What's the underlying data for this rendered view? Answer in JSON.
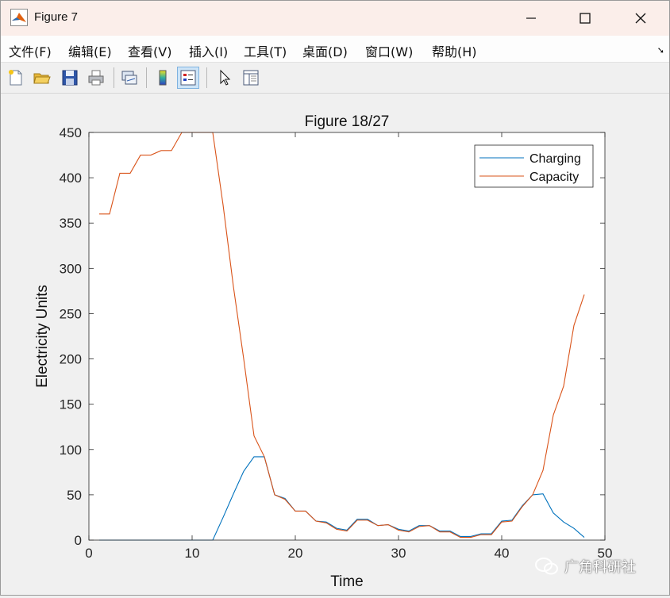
{
  "window": {
    "title": "Figure 7"
  },
  "menu": {
    "items": [
      "文件(F)",
      "编辑(E)",
      "查看(V)",
      "插入(I)",
      "工具(T)",
      "桌面(D)",
      "窗口(W)",
      "帮助(H)"
    ]
  },
  "toolbar": {
    "buttons": [
      "new-figure",
      "open-file",
      "save",
      "print",
      "link-plot",
      "insert-colorbar",
      "insert-legend",
      "edit-plot-pointer",
      "property-inspector"
    ],
    "active": "insert-legend"
  },
  "watermark": {
    "text": "广角科研社"
  },
  "colors": {
    "charging": "#0072BD",
    "capacity": "#D95319",
    "plot_bg": "#ffffff",
    "figure_bg": "#f0f0f0"
  },
  "chart_data": {
    "type": "line",
    "title": "Figure 18/27",
    "xlabel": "Time",
    "ylabel": "Electricity Units",
    "xlim": [
      0,
      50
    ],
    "ylim": [
      0,
      450
    ],
    "xticks": [
      0,
      10,
      20,
      30,
      40,
      50
    ],
    "yticks": [
      0,
      50,
      100,
      150,
      200,
      250,
      300,
      350,
      400,
      450
    ],
    "grid": false,
    "legend_position": "top-right",
    "x": [
      1,
      2,
      3,
      4,
      5,
      6,
      7,
      8,
      9,
      10,
      11,
      12,
      13,
      14,
      15,
      16,
      17,
      18,
      19,
      20,
      21,
      22,
      23,
      24,
      25,
      26,
      27,
      28,
      29,
      30,
      31,
      32,
      33,
      34,
      35,
      36,
      37,
      38,
      39,
      40,
      41,
      42,
      43,
      44,
      45,
      46,
      47,
      48
    ],
    "series": [
      {
        "name": "Charging",
        "color": "#0072BD",
        "values": [
          0,
          0,
          0,
          0,
          0,
          0,
          0,
          0,
          0,
          0,
          0,
          0,
          25,
          51,
          76,
          92,
          92,
          50,
          46,
          32,
          32,
          21,
          20,
          13,
          11,
          23,
          23,
          16,
          17,
          12,
          10,
          16,
          16,
          10,
          10,
          4,
          4,
          7,
          7,
          21,
          22,
          38,
          50,
          51,
          30,
          20,
          13,
          3
        ]
      },
      {
        "name": "Capacity",
        "color": "#D95319",
        "values": [
          360,
          360,
          405,
          405,
          425,
          425,
          430,
          430,
          450,
          450,
          450,
          450,
          370,
          280,
          200,
          115,
          92,
          50,
          45,
          32,
          32,
          21,
          19,
          12,
          10,
          22,
          22,
          16,
          17,
          11,
          9,
          15,
          16,
          9,
          9,
          3,
          3,
          6,
          6,
          20,
          21,
          37,
          50,
          77,
          138,
          170,
          237,
          271
        ]
      }
    ]
  }
}
